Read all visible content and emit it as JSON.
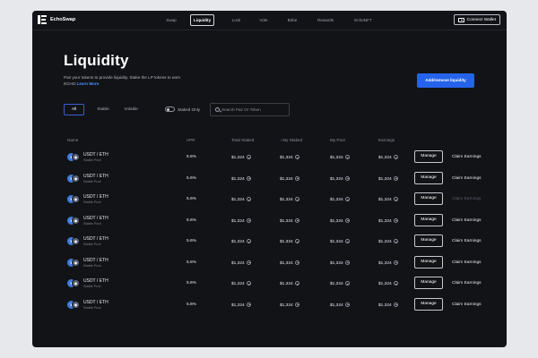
{
  "app": {
    "name": "EchoSwap"
  },
  "nav": {
    "items": [
      "Swap",
      "Liquidity",
      "Lock",
      "Vote",
      "Bribe",
      "Rewards",
      "EchoNFT"
    ],
    "active": "Liquidity",
    "connect_label": "Connect Wallet"
  },
  "header": {
    "title": "Liquidity",
    "subtitle": "Pair your tokens to provide liquidity. Stake the LP tokens to earn ECHO.",
    "learn_more": "Learn More",
    "add_button": "Add/remove liquidity"
  },
  "filters": {
    "tabs": [
      "All",
      "Stable",
      "Volatile"
    ],
    "active": "All",
    "staked_only_label": "Staked Only",
    "staked_only_on": false,
    "search_placeholder": "Search Pair Or Token"
  },
  "table": {
    "columns": [
      "Name",
      "APR",
      "Total Staked",
      "My Staked",
      "My Pool",
      "Earnings"
    ],
    "sorted_column": "My Staked",
    "manage_label": "Manage",
    "claim_label": "Claim Earnings",
    "rows": [
      {
        "pair": "USDT / ETH",
        "type": "Stable Pool",
        "apr": "5.6%",
        "total_staked": "$1,324",
        "my_staked": "$1,324",
        "my_pool": "$1,324",
        "earnings": "$1,324",
        "claim_enabled": true
      },
      {
        "pair": "USDT / ETH",
        "type": "Stable Pool",
        "apr": "5.6%",
        "total_staked": "$1,324",
        "my_staked": "$1,324",
        "my_pool": "$1,324",
        "earnings": "$1,324",
        "claim_enabled": true
      },
      {
        "pair": "USDT / ETH",
        "type": "Stable Pool",
        "apr": "5.6%",
        "total_staked": "$1,324",
        "my_staked": "$1,324",
        "my_pool": "$1,324",
        "earnings": "$1,324",
        "claim_enabled": false
      },
      {
        "pair": "USDT / ETH",
        "type": "Stable Pool",
        "apr": "5.6%",
        "total_staked": "$1,324",
        "my_staked": "$1,324",
        "my_pool": "$1,324",
        "earnings": "$1,324",
        "claim_enabled": true
      },
      {
        "pair": "USDT / ETH",
        "type": "Stable Pool",
        "apr": "5.6%",
        "total_staked": "$1,324",
        "my_staked": "$1,324",
        "my_pool": "$1,324",
        "earnings": "$1,324",
        "claim_enabled": true
      },
      {
        "pair": "USDT / ETH",
        "type": "Stable Pool",
        "apr": "5.6%",
        "total_staked": "$1,324",
        "my_staked": "$1,324",
        "my_pool": "$1,324",
        "earnings": "$1,324",
        "claim_enabled": true
      },
      {
        "pair": "USDT / ETH",
        "type": "Stable Pool",
        "apr": "5.6%",
        "total_staked": "$1,324",
        "my_staked": "$1,324",
        "my_pool": "$1,324",
        "earnings": "$1,324",
        "claim_enabled": true
      },
      {
        "pair": "USDT / ETH",
        "type": "Stable Pool",
        "apr": "5.6%",
        "total_staked": "$1,324",
        "my_staked": "$1,324",
        "my_pool": "$1,324",
        "earnings": "$1,324",
        "claim_enabled": true
      }
    ]
  },
  "colors": {
    "accent": "#2563eb",
    "link": "#4d8cff",
    "background": "#121317",
    "page": "#e6e8ec"
  }
}
